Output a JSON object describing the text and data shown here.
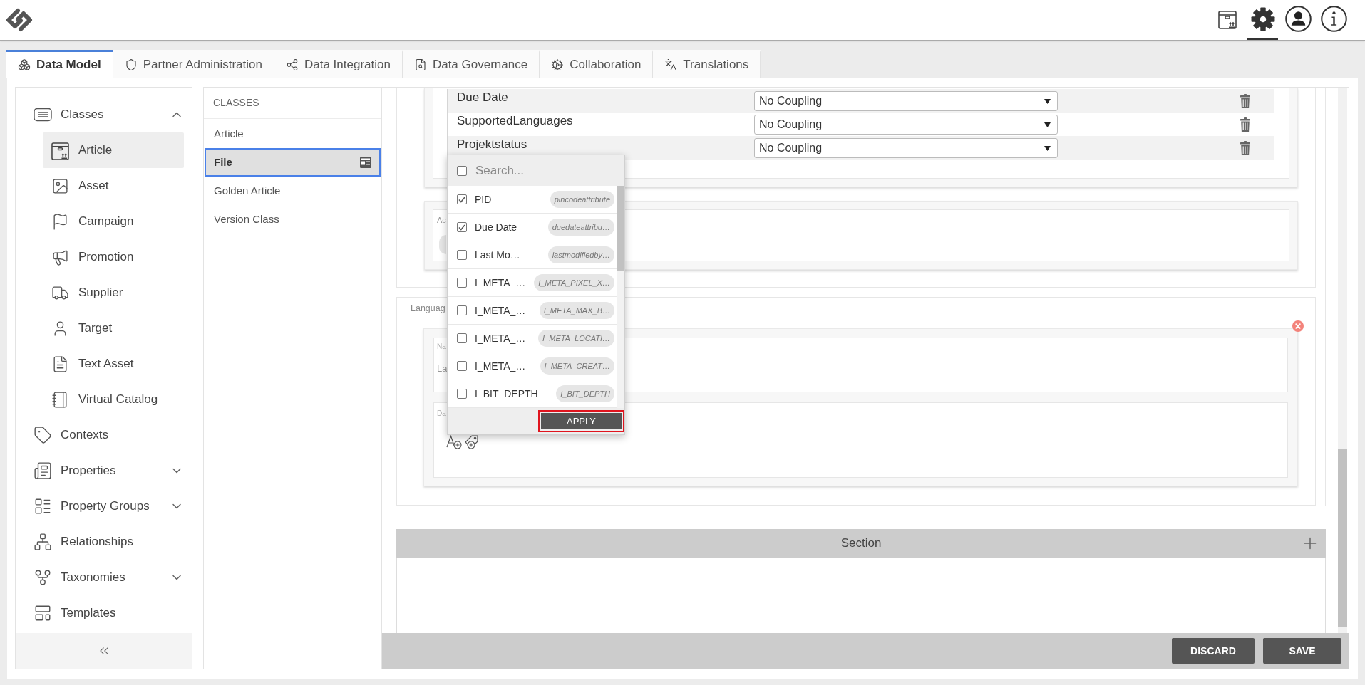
{
  "header": {
    "icons": [
      {
        "kind": "package",
        "selected": false
      },
      {
        "kind": "settings",
        "selected": true
      },
      {
        "kind": "user",
        "selected": false
      },
      {
        "kind": "info",
        "selected": false
      }
    ]
  },
  "tabs": [
    {
      "label": "Data Model",
      "selected": true
    },
    {
      "label": "Partner Administration",
      "selected": false
    },
    {
      "label": "Data Integration",
      "selected": false
    },
    {
      "label": "Data Governance",
      "selected": false
    },
    {
      "label": "Collaboration",
      "selected": false
    },
    {
      "label": "Translations",
      "selected": false
    }
  ],
  "sidebar": {
    "items": [
      {
        "label": "Classes",
        "kind": "group",
        "expanded": true,
        "selected": false,
        "children": [
          {
            "label": "Article",
            "selected": true
          },
          {
            "label": "Asset",
            "selected": false
          },
          {
            "label": "Campaign",
            "selected": false
          },
          {
            "label": "Promotion",
            "selected": false
          },
          {
            "label": "Supplier",
            "selected": false
          },
          {
            "label": "Target",
            "selected": false
          },
          {
            "label": "Text Asset",
            "selected": false
          },
          {
            "label": "Virtual Catalog",
            "selected": false
          }
        ]
      },
      {
        "label": "Contexts",
        "kind": "link",
        "selected": false
      },
      {
        "label": "Properties",
        "kind": "group",
        "expanded": false,
        "selected": false
      },
      {
        "label": "Property Groups",
        "kind": "group",
        "expanded": false,
        "selected": false
      },
      {
        "label": "Relationships",
        "kind": "link",
        "selected": false
      },
      {
        "label": "Taxonomies",
        "kind": "group",
        "expanded": false,
        "selected": false
      },
      {
        "label": "Templates",
        "kind": "link",
        "selected": false
      }
    ]
  },
  "classes_panel": {
    "title": "CLASSES",
    "items": [
      {
        "label": "Article",
        "selected": false
      },
      {
        "label": "File",
        "selected": true
      },
      {
        "label": "Golden Article",
        "selected": false
      },
      {
        "label": "Version Class",
        "selected": false
      }
    ]
  },
  "main": {
    "coupling_rows": [
      {
        "name": "Due Date",
        "coupling": "No Coupling"
      },
      {
        "name": "SupportedLanguages",
        "coupling": "No Coupling"
      },
      {
        "name": "Projektstatus",
        "coupling": "No Coupling"
      }
    ],
    "attributes_card": {
      "label": "Ac"
    },
    "language_card": {
      "label": "Languag",
      "name_field": {
        "label": "Na",
        "value": "La"
      },
      "description_field": {
        "label": "Da"
      }
    },
    "section": {
      "title": "Section"
    }
  },
  "attribute_picker": {
    "search": {
      "placeholder": "Search...",
      "checked": false
    },
    "options": [
      {
        "label": "PID",
        "code": "pincodeattribute",
        "checked": true
      },
      {
        "label": "Due Date",
        "code": "duedateattribu…",
        "checked": true
      },
      {
        "label": "Last Mo…",
        "code": "lastmodifiedby…",
        "checked": false
      },
      {
        "label": "I_META_…",
        "code": "I_META_PIXEL_X…",
        "checked": false
      },
      {
        "label": "I_META_…",
        "code": "I_META_MAX_B…",
        "checked": false
      },
      {
        "label": "I_META_…",
        "code": "I_META_LOCATI…",
        "checked": false
      },
      {
        "label": "I_META_…",
        "code": "I_META_CREAT…",
        "checked": false
      },
      {
        "label": "I_BIT_DEPTH",
        "code": "I_BIT_DEPTH",
        "checked": false
      }
    ],
    "apply_button": {
      "label": "APPLY",
      "highlighted": true
    }
  },
  "actions": [
    {
      "label": "DISCARD"
    },
    {
      "label": "SAVE"
    }
  ]
}
